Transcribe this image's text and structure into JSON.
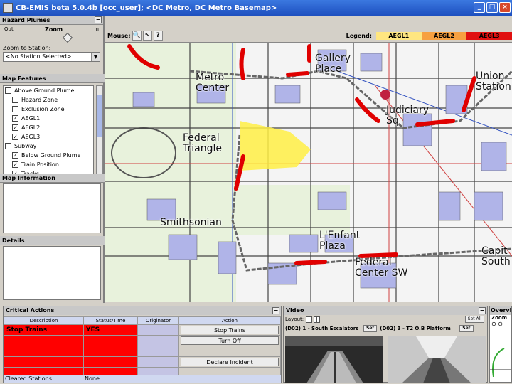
{
  "window": {
    "title": "CB-EMIS beta 5.0.4b [occ_user]; <DC Metro, DC Metro Basemap>"
  },
  "hazard_plumes": {
    "title": "Hazard Plumes",
    "zoom_label": "Zoom",
    "zoom_out": "Out",
    "zoom_in": "In",
    "zoom_to_station_label": "Zoom to Station:",
    "station_select": "<No Station Selected>"
  },
  "map_features": {
    "title": "Map Features",
    "items": [
      {
        "label": "Above Ground Plume",
        "checked": false
      },
      {
        "label": "Hazard Zone",
        "checked": false
      },
      {
        "label": "Exclusion Zone",
        "checked": false
      },
      {
        "label": "AEGL1",
        "checked": true
      },
      {
        "label": "AEGL2",
        "checked": true
      },
      {
        "label": "AEGL3",
        "checked": true
      },
      {
        "label": "Subway",
        "checked": false
      },
      {
        "label": "Below Ground Plume",
        "checked": true
      },
      {
        "label": "Train Position",
        "checked": true
      },
      {
        "label": "Tracks",
        "checked": true
      }
    ]
  },
  "map_information": {
    "title": "Map Information"
  },
  "details": {
    "title": "Details"
  },
  "map_toolbar": {
    "mouse_label": "Mouse:",
    "legend_label": "Legend:",
    "legend": [
      {
        "label": "AEGL1",
        "color": "#ffe680"
      },
      {
        "label": "AEGL2",
        "color": "#f7a040"
      },
      {
        "label": "AEGL3",
        "color": "#e01010"
      }
    ]
  },
  "map": {
    "stations": {
      "gallery": "Gallery\nPlace",
      "metro_center": "Metro\nCenter",
      "union": "Union\nStation",
      "judiciary": "Judiciary\nSq",
      "federal_triangle": "Federal\nTriangle",
      "smithsonian": "Smithsonian",
      "lenfant": "L'Enfant\nPlaza",
      "federal_center": "Federal\nCenter SW",
      "capitol_south": "Capit\nSouth"
    }
  },
  "critical_actions": {
    "title": "Critical Actions",
    "columns": [
      "Description",
      "Status/Time",
      "Originator",
      "Action"
    ],
    "rows": [
      {
        "description": "Stop Trains",
        "status": "YES",
        "originator": "",
        "action": "Stop Trains"
      },
      {
        "description": "",
        "status": "",
        "originator": "",
        "action": "Turn Off"
      },
      {
        "description": "",
        "status": "",
        "originator": "",
        "action": ""
      },
      {
        "description": "",
        "status": "",
        "originator": "",
        "action": "Declare Incident"
      },
      {
        "description": "",
        "status": "",
        "originator": "",
        "action": ""
      }
    ],
    "cleared_label": "Cleared Stations",
    "cleared_value": "None"
  },
  "video": {
    "title": "Video",
    "layout_label": "Layout:",
    "set_all": "Set All",
    "camera1": "(D02) 1 - South Escalators",
    "camera2": "(D02) 3 - T2 O.B Platform",
    "set": "Set"
  },
  "overview": {
    "title": "Overvi",
    "zoom_label": "Zoom"
  }
}
